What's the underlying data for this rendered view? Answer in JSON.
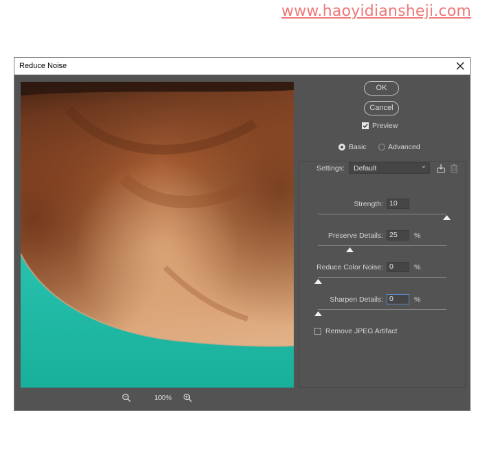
{
  "watermark": {
    "text": "www.haoyidiansheji.com"
  },
  "dialog": {
    "title": "Reduce Noise"
  },
  "buttons": {
    "ok": "OK",
    "cancel": "Cancel"
  },
  "preview_toggle": {
    "label": "Preview",
    "checked": true
  },
  "mode": {
    "basic": "Basic",
    "advanced": "Advanced",
    "selected": "Basic"
  },
  "settings": {
    "label": "Settings:",
    "value": "Default"
  },
  "strength": {
    "label": "Strength:",
    "value": "10",
    "slider_fraction": 1.0
  },
  "preserve_details": {
    "label": "Preserve Details:",
    "value": "25",
    "unit": "%",
    "slider_fraction": 0.25
  },
  "reduce_color_noise": {
    "label": "Reduce Color Noise:",
    "value": "0",
    "unit": "%",
    "slider_fraction": 0.0
  },
  "sharpen_details": {
    "label": "Sharpen Details:",
    "value": "0",
    "unit": "%",
    "slider_fraction": 0.0
  },
  "remove_jpeg": {
    "label": "Remove JPEG Artifact",
    "checked": false
  },
  "zoom": {
    "level": "100%"
  },
  "icons": {
    "close": "close-icon",
    "zoom_out": "zoom-out-icon",
    "zoom_in": "zoom-in-icon",
    "save_preset": "save-preset-icon",
    "delete_preset": "trash-icon",
    "dropdown": "chevron-down-icon"
  },
  "colors": {
    "dialog_bg": "#535353",
    "shirt_teal": "#1fb8a3",
    "skin": "#c98a5a",
    "watermark": "#ee7777"
  }
}
